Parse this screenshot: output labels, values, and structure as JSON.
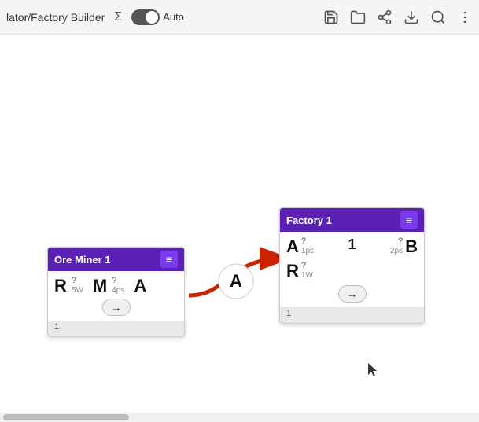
{
  "toolbar": {
    "title": "lator/Factory Builder",
    "sigma_label": "Σ",
    "auto_label": "Auto",
    "toggle_active": true,
    "icons": [
      "save",
      "folder",
      "share",
      "download",
      "search",
      "more"
    ]
  },
  "canvas": {
    "background": "#ffffff"
  },
  "ore_miner": {
    "title": "Ore Miner 1",
    "header_btn": "≡",
    "pins": [
      {
        "label": "R",
        "q": "?",
        "rate": "5W"
      },
      {
        "label": "M",
        "q": "?",
        "rate": "4ps"
      },
      {
        "label": "A",
        "q": "",
        "rate": ""
      }
    ],
    "arrow_btn": "→",
    "footer": "1"
  },
  "factory": {
    "title": "Factory 1",
    "header_btn": "≡",
    "pins_left": [
      {
        "label": "A",
        "q": "?",
        "rate": "1ps"
      },
      {
        "label": "R",
        "q": "?",
        "rate": "1W"
      }
    ],
    "center_number": "1",
    "pins_right": [
      {
        "label": "B",
        "q": "?",
        "rate": "2ps"
      }
    ],
    "arrow_btn": "→",
    "footer": "1"
  },
  "connection": {
    "label": "A"
  },
  "cursor": "▲"
}
